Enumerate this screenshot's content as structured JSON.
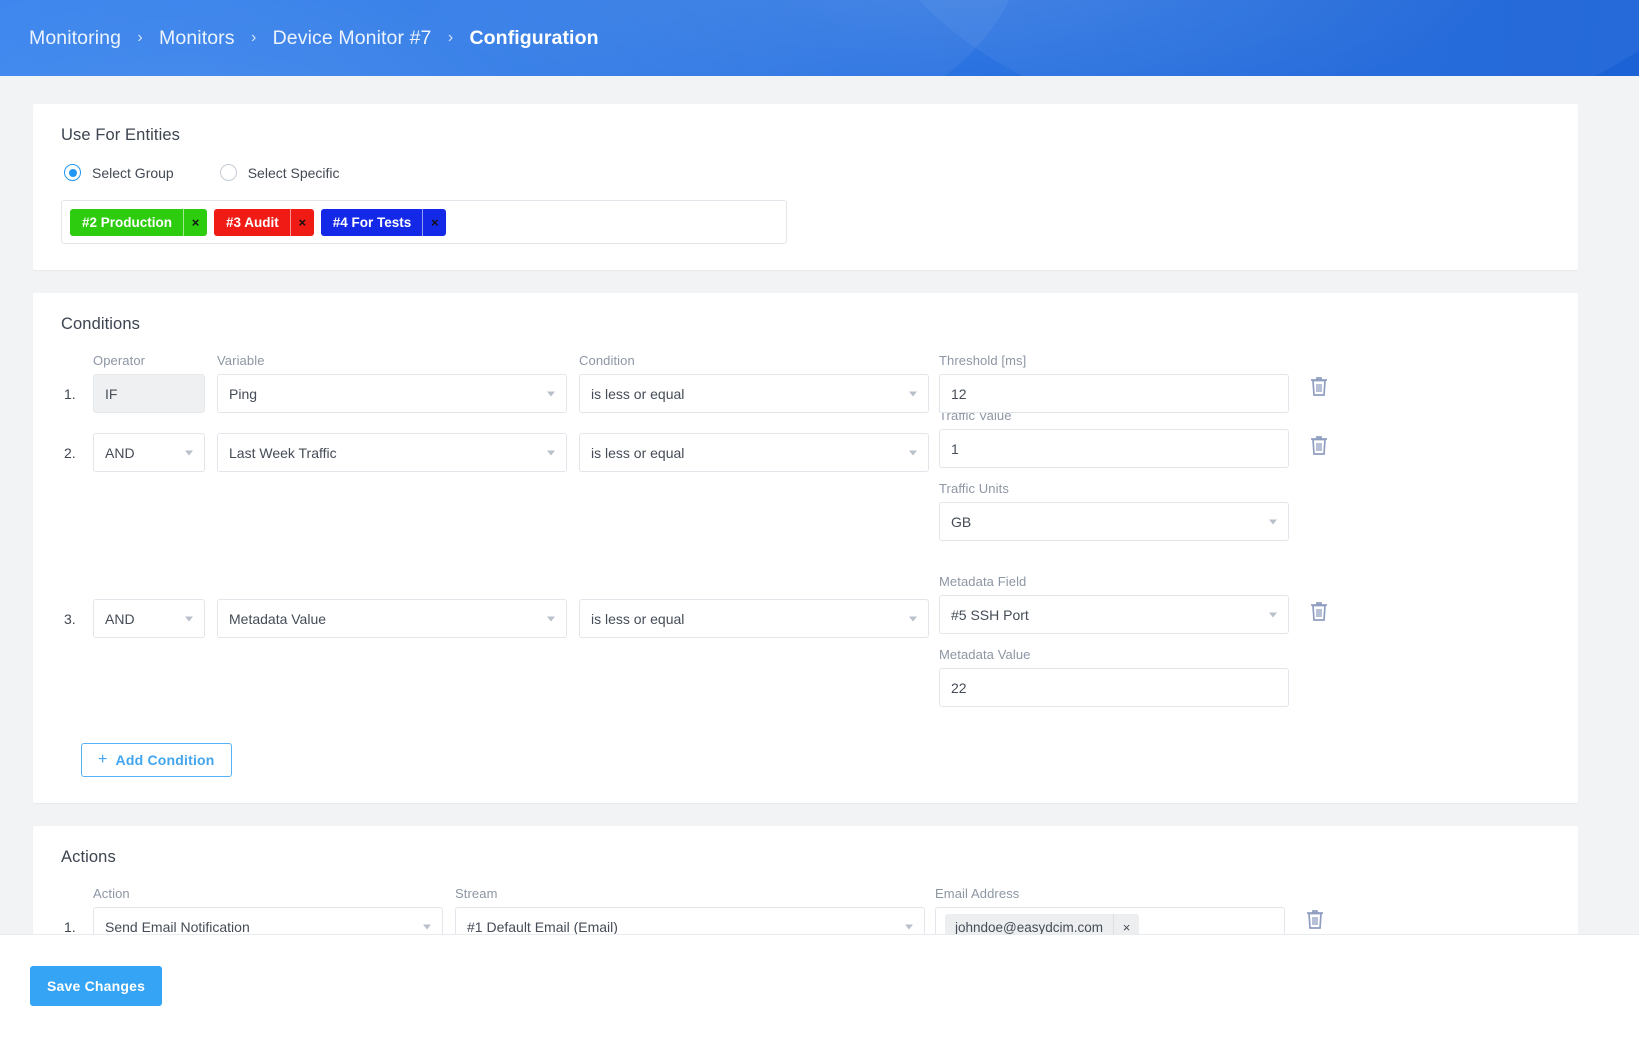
{
  "breadcrumb": {
    "items": [
      {
        "label": "Monitoring",
        "current": false
      },
      {
        "label": "Monitors",
        "current": false
      },
      {
        "label": "Device Monitor #7",
        "current": false
      },
      {
        "label": "Configuration",
        "current": true
      }
    ],
    "separator": "›"
  },
  "entities": {
    "title": "Use For Entities",
    "radios": [
      {
        "label": "Select Group",
        "selected": true
      },
      {
        "label": "Select Specific",
        "selected": false
      }
    ],
    "tags": [
      {
        "label": "#2 Production",
        "color": "#2ecc0f",
        "remove": "×"
      },
      {
        "label": "#3 Audit",
        "color": "#ef1b14",
        "remove": "×"
      },
      {
        "label": "#4 For Tests",
        "color": "#1429e8",
        "remove": "×"
      }
    ]
  },
  "conditions": {
    "title": "Conditions",
    "headers": {
      "operator": "Operator",
      "variable": "Variable",
      "condition": "Condition"
    },
    "rows": [
      {
        "index": "1.",
        "operator": "IF",
        "operator_disabled": true,
        "variable": "Ping",
        "condition": "is less or equal",
        "extras": [
          {
            "label": "Threshold [ms]",
            "value": "12",
            "type": "input"
          }
        ]
      },
      {
        "index": "2.",
        "operator": "AND",
        "operator_disabled": false,
        "variable": "Last Week Traffic",
        "condition": "is less or equal",
        "extras": [
          {
            "label": "Traffic Value",
            "value": "1",
            "type": "input"
          },
          {
            "label": "Traffic Units",
            "value": "GB",
            "type": "select"
          }
        ]
      },
      {
        "index": "3.",
        "operator": "AND",
        "operator_disabled": false,
        "variable": "Metadata Value",
        "condition": "is less or equal",
        "extras": [
          {
            "label": "Metadata Field",
            "value": "#5 SSH Port",
            "type": "select"
          },
          {
            "label": "Metadata Value",
            "value": "22",
            "type": "input"
          }
        ]
      }
    ],
    "add_button": {
      "plus": "+",
      "label": "Add Condition"
    }
  },
  "actions": {
    "title": "Actions",
    "headers": {
      "action": "Action",
      "stream": "Stream",
      "email": "Email Address"
    },
    "rows": [
      {
        "index": "1.",
        "action": "Send Email Notification",
        "stream": "#1 Default Email (Email)",
        "email_chip": {
          "label": "johndoe@easydcim.com",
          "remove": "×"
        }
      }
    ]
  },
  "footer": {
    "save_label": "Save Changes"
  },
  "theme": {
    "topbar_blue": "#1d68dd",
    "accent_blue": "#36a4f4",
    "link_blue": "#41a5f0"
  }
}
